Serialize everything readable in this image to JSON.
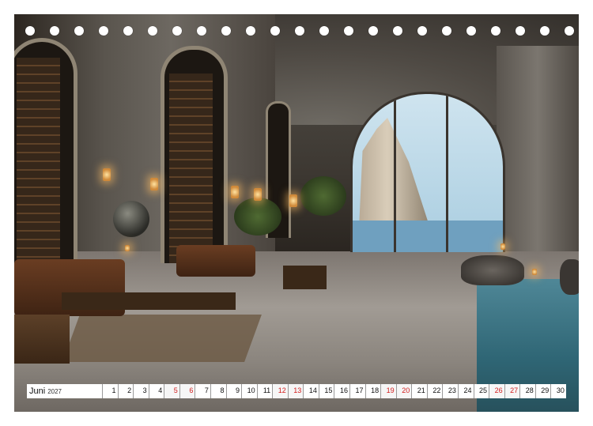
{
  "calendar": {
    "month": "Juni",
    "year": "2027",
    "days": [
      "1",
      "2",
      "3",
      "4",
      "5",
      "6",
      "7",
      "8",
      "9",
      "10",
      "11",
      "12",
      "13",
      "14",
      "15",
      "16",
      "17",
      "18",
      "19",
      "20",
      "21",
      "22",
      "23",
      "24",
      "25",
      "26",
      "27",
      "28",
      "29",
      "30"
    ],
    "red_days": [
      "5",
      "6",
      "12",
      "13",
      "19",
      "20",
      "26",
      "27"
    ],
    "weekend_color": "#d21e1e"
  },
  "photo": {
    "subject": "cave library lounge with arched sea window"
  }
}
